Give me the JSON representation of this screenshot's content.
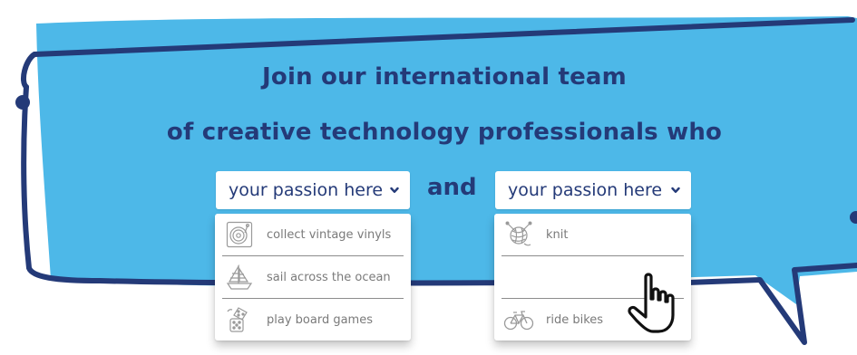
{
  "headline": {
    "line1": "Join our international team",
    "line2": "of creative technology professionals who"
  },
  "conjunction": "and",
  "selects": [
    {
      "value": "your passion here",
      "options": [
        {
          "label": "collect vintage vinyls",
          "icon": "vinyl-record-icon"
        },
        {
          "label": "sail across the ocean",
          "icon": "sailboat-icon"
        },
        {
          "label": "play board games",
          "icon": "dice-icon"
        }
      ]
    },
    {
      "value": "your passion here",
      "options": [
        {
          "label": "knit",
          "icon": "yarn-ball-icon"
        },
        {
          "label": "",
          "icon": ""
        },
        {
          "label": "ride bikes",
          "icon": "bicycle-icon"
        }
      ]
    }
  ],
  "colors": {
    "bubble_fill": "#4db8e8",
    "outline": "#243a78",
    "text": "#243a78",
    "option_text": "#7a7a7a"
  }
}
